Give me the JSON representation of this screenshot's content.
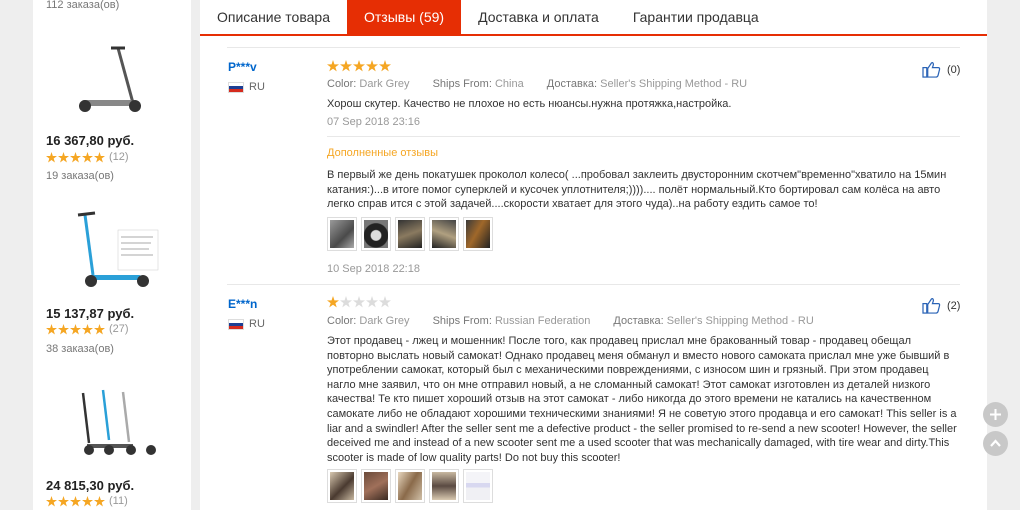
{
  "sidebar": {
    "top_orders": "112 заказа(ов)",
    "products": [
      {
        "price": "16 367,80 руб.",
        "reviews": "(12)",
        "orders": "19 заказа(ов)",
        "stars": 5
      },
      {
        "price": "15 137,87 руб.",
        "reviews": "(27)",
        "orders": "38 заказа(ов)",
        "stars": 5
      },
      {
        "price": "24 815,30 руб.",
        "reviews": "(11)",
        "orders": "",
        "stars": 5
      }
    ]
  },
  "tabs": [
    {
      "label": "Описание товара",
      "active": false
    },
    {
      "label": "Отзывы (59)",
      "active": true
    },
    {
      "label": "Доставка и оплата",
      "active": false
    },
    {
      "label": "Гарантии продавца",
      "active": false
    }
  ],
  "reviews": [
    {
      "user": "P***v",
      "country": "RU",
      "stars": 5,
      "color_label": "Color:",
      "color": "Dark Grey",
      "ships_label": "Ships From:",
      "ships": "China",
      "delivery_label": "Доставка:",
      "delivery": "Seller's Shipping Method - RU",
      "text": "Хорош скутер. Качество не плохое но есть нюансы.нужна протяжка,настройка.",
      "date": "07 Sep 2018 23:16",
      "helpful": "(0)",
      "additional_label": "Дополненные отзывы",
      "additional_text": "В первый же день покатушек проколол колесо( ...пробовал заклеить двусторонним скотчем\"временно\"хватило на 15мин катания:)...в итоге помог суперклей и кусочек уплотнителя;)))).... полёт нормальный.Кто бортировал сам колёса на авто легко справ ится с этой задачей....скорости хватает для этого чуда)..на работу ездить самое то!",
      "additional_date": "10 Sep 2018 22:18"
    },
    {
      "user": "E***n",
      "country": "RU",
      "stars": 1,
      "color_label": "Color:",
      "color": "Dark Grey",
      "ships_label": "Ships From:",
      "ships": "Russian Federation",
      "delivery_label": "Доставка:",
      "delivery": "Seller's Shipping Method - RU",
      "text": "Этот продавец - лжец и мошенник! После того, как продавец прислал мне бракованный товар - продавец обещал повторно выслать новый самокат! Однако продавец меня обманул и вместо нового самоката прислал мне уже бывший в употреблении самокат, который был с механическими повреждениями, с износом шин и грязный. При этом продавец нагло мне заявил, что он мне отправил новый, а не сломанный самокат! Этот самокат изготовлен из деталей низкого качества! Те кто пишет хороший отзыв на этот самокат - либо никогда до этого времени не катались на качественном самокате либо не обладают хорошими техническими знаниями! Я не советую этого продавца и его самокат! This seller is a liar and a swindler! After the seller sent me a defective product - the seller promised to re-send a new scooter! However, the seller deceived me and instead of a new scooter sent me a used scooter that was mechanically damaged, with tire wear and dirty.This scooter is made of low quality parts! Do not buy this scooter!",
      "helpful": "(2)"
    }
  ],
  "colors": {
    "accent": "#e62e04",
    "star": "#f5a623",
    "link": "#0066cc"
  }
}
